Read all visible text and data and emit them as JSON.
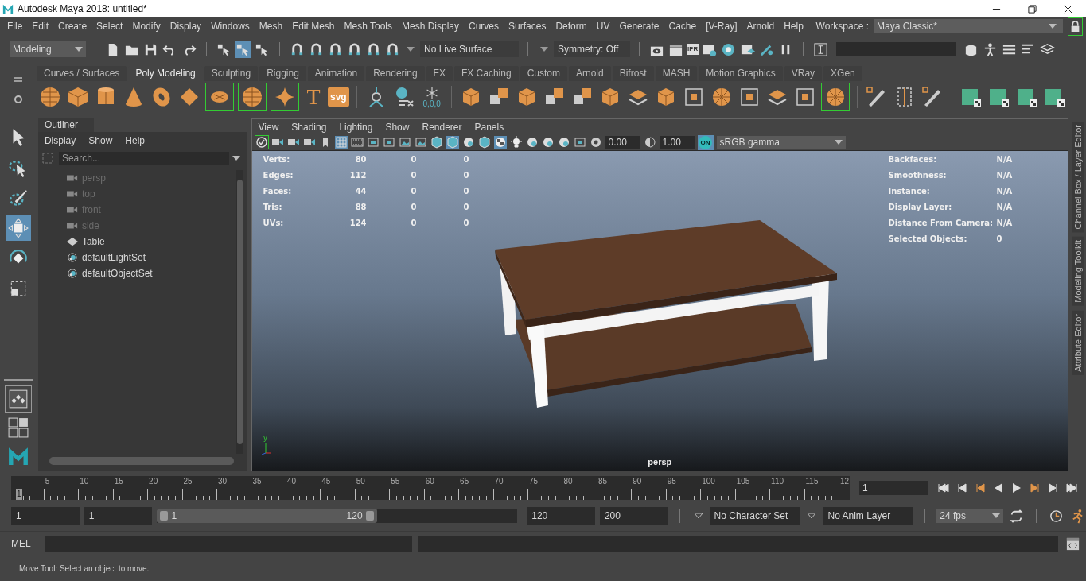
{
  "window": {
    "title": "Autodesk Maya 2018: untitled*"
  },
  "menu_bar": {
    "items": [
      "File",
      "Edit",
      "Create",
      "Select",
      "Modify",
      "Display",
      "Windows",
      "Mesh",
      "Edit Mesh",
      "Mesh Tools",
      "Mesh Display",
      "Curves",
      "Surfaces",
      "Deform",
      "UV",
      "Generate",
      "Cache",
      "[V-Ray]",
      "Arnold",
      "Help"
    ],
    "workspace_label": "Workspace :",
    "workspace": "Maya Classic*"
  },
  "status_line": {
    "menu_set": "Modeling",
    "live_surface": "No Live Surface",
    "symmetry": "Symmetry: Off",
    "ipr_label": "IPR"
  },
  "shelf": {
    "tabs": [
      {
        "label": "Curves / Surfaces",
        "selected": false
      },
      {
        "label": "Poly Modeling",
        "selected": true
      },
      {
        "label": "Sculpting",
        "selected": false
      },
      {
        "label": "Rigging",
        "selected": false
      },
      {
        "label": "Animation",
        "selected": false
      },
      {
        "label": "Rendering",
        "selected": false
      },
      {
        "label": "FX",
        "selected": false
      },
      {
        "label": "FX Caching",
        "selected": false
      },
      {
        "label": "Custom",
        "selected": false
      },
      {
        "label": "Arnold",
        "selected": false
      },
      {
        "label": "Bifrost",
        "selected": false
      },
      {
        "label": "MASH",
        "selected": false
      },
      {
        "label": "Motion Graphics",
        "selected": false
      },
      {
        "label": "VRay",
        "selected": false
      },
      {
        "label": "XGen",
        "selected": false
      }
    ],
    "type_icon": "T",
    "svg_icon": "svg",
    "freeze_label": "0,0,0"
  },
  "outliner": {
    "title": "Outliner",
    "menus": [
      "Display",
      "Show",
      "Help"
    ],
    "search": {
      "placeholder": "Search..."
    },
    "items": [
      {
        "label": "persp",
        "kind": "camera",
        "dimmed": true
      },
      {
        "label": "top",
        "kind": "camera",
        "dimmed": true
      },
      {
        "label": "front",
        "kind": "camera",
        "dimmed": true
      },
      {
        "label": "side",
        "kind": "camera",
        "dimmed": true
      },
      {
        "label": "Table",
        "kind": "group",
        "dimmed": false
      },
      {
        "label": "defaultLightSet",
        "kind": "set",
        "dimmed": false
      },
      {
        "label": "defaultObjectSet",
        "kind": "set",
        "dimmed": false
      }
    ]
  },
  "viewport": {
    "menus": [
      "View",
      "Shading",
      "Lighting",
      "Show",
      "Renderer",
      "Panels"
    ],
    "exposure": "0.00",
    "gamma": "1.00",
    "color_management": "ON",
    "view_transform": "sRGB gamma",
    "stats": [
      {
        "label": "Verts:",
        "values": [
          "80",
          "0",
          "0"
        ]
      },
      {
        "label": "Edges:",
        "values": [
          "112",
          "0",
          "0"
        ]
      },
      {
        "label": "Faces:",
        "values": [
          "44",
          "0",
          "0"
        ]
      },
      {
        "label": "Tris:",
        "values": [
          "88",
          "0",
          "0"
        ]
      },
      {
        "label": "UVs:",
        "values": [
          "124",
          "0",
          "0"
        ]
      }
    ],
    "info": [
      {
        "label": "Backfaces:",
        "value": "N/A"
      },
      {
        "label": "Smoothness:",
        "value": "N/A"
      },
      {
        "label": "Instance:",
        "value": "N/A"
      },
      {
        "label": "Display Layer:",
        "value": "N/A"
      },
      {
        "label": "Distance From Camera:",
        "value": "N/A"
      },
      {
        "label": "Selected Objects:",
        "value": "0"
      }
    ],
    "axis_label": "y",
    "camera": "persp"
  },
  "side_tabs": [
    "Channel Box / Layer Editor",
    "Modeling Toolkit",
    "Attribute Editor"
  ],
  "time_slider": {
    "level": 0,
    "start": "1",
    "ticks": [
      "5",
      "10",
      "15",
      "20",
      "25",
      "30",
      "35",
      "40",
      "45",
      "50",
      "55",
      "60",
      "65",
      "70",
      "75",
      "80",
      "85",
      "90",
      "95",
      "100",
      "105",
      "110",
      "115",
      "12"
    ],
    "current_frame": "1"
  },
  "range_slider": {
    "level": 0.61,
    "start": "1",
    "playback_start": "1",
    "range_start": "1",
    "range_end": "120",
    "playback_end": "120",
    "end": "200",
    "character_set": "No Character Set",
    "anim_layer": "No Anim Layer",
    "fps": "24 fps"
  },
  "command_line": {
    "language": "MEL"
  },
  "help_line": "Move Tool: Select an object to move."
}
